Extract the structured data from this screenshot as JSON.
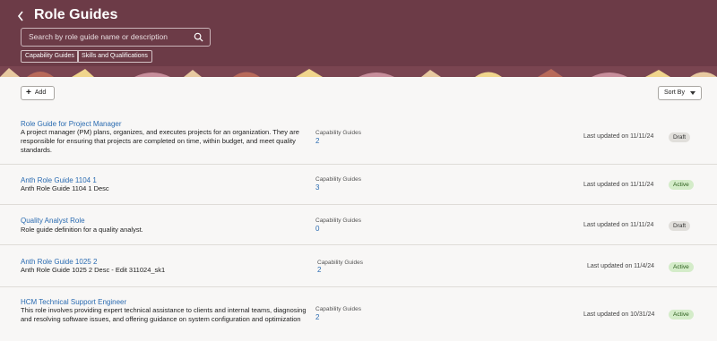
{
  "header": {
    "title": "Role Guides",
    "search_placeholder": "Search by role guide name or description",
    "chips": [
      "Capability Guides",
      "Skills and Qualifications"
    ]
  },
  "toolbar": {
    "add_label": "Add",
    "sort_label": "Sort By"
  },
  "cap_label": "Capability Guides",
  "rows": [
    {
      "name": "Role Guide for Project Manager",
      "description": "A project manager (PM) plans, organizes, and executes projects for an organization. They are responsible for ensuring that projects are completed on time, within budget, and meet quality standards.",
      "capability_count": "2",
      "updated": "Last updated on 11/11/24",
      "status": "Draft"
    },
    {
      "name": "Anth Role Guide 1104 1",
      "description": "Anth Role Guide 1104 1 Desc",
      "capability_count": "3",
      "updated": "Last updated on 11/11/24",
      "status": "Active"
    },
    {
      "name": "Quality Analyst Role",
      "description": "Role guide definition for a quality analyst.",
      "capability_count": "0",
      "updated": "Last updated on 11/11/24",
      "status": "Draft"
    },
    {
      "name": "Anth Role Guide 1025 2",
      "description": "Anth Role Guide 1025 2 Desc - Edit 311024_sk1",
      "capability_count": "2",
      "updated": "Last updated on 11/4/24",
      "status": "Active"
    },
    {
      "name": "HCM Technical Support Engineer",
      "description": "This role involves providing expert technical assistance to clients and internal teams, diagnosing and resolving software issues, and offering guidance on system configuration and optimization",
      "capability_count": "2",
      "updated": "Last updated on 10/31/24",
      "status": "Active"
    }
  ],
  "colors": {
    "header_bg": "#6c3b47",
    "link": "#2a6bb1",
    "active_badge": "#d4ecc9",
    "draft_badge": "#e1dfdb"
  }
}
